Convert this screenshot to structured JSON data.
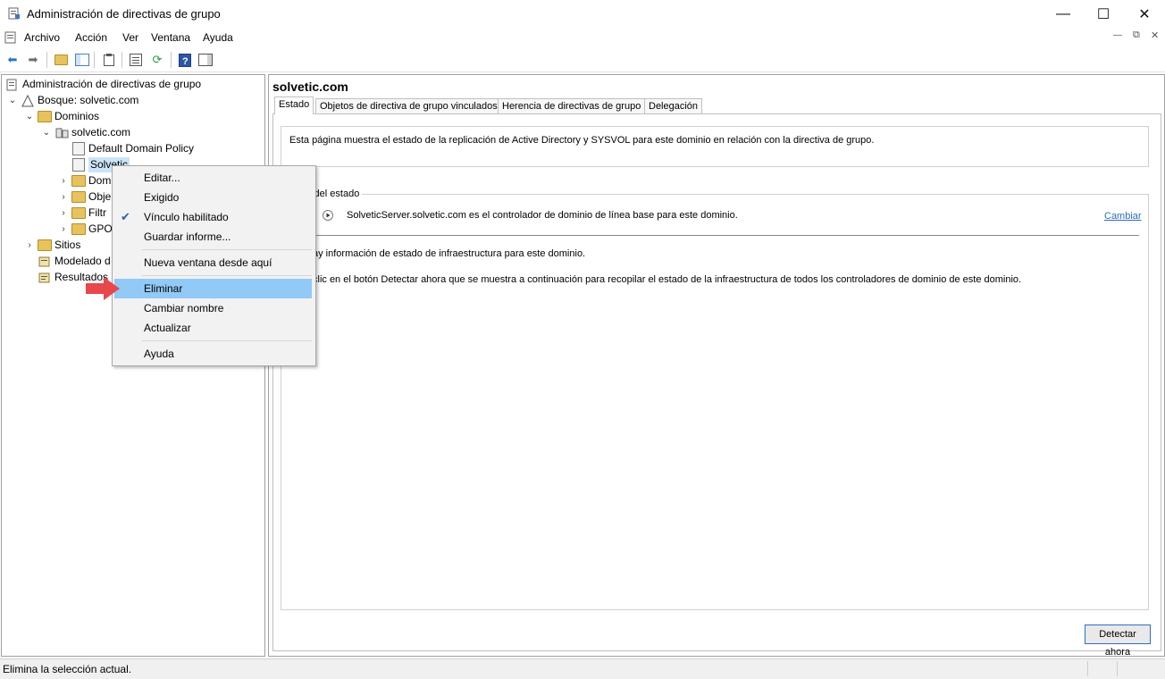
{
  "window": {
    "title": "Administración de directivas de grupo"
  },
  "menu": [
    "Archivo",
    "Acción",
    "Ver",
    "Ventana",
    "Ayuda"
  ],
  "tree": {
    "root": "Administración de directivas de grupo",
    "forest": "Bosque: solvetic.com",
    "domains": "Dominios",
    "domain": "solvetic.com",
    "ddp": "Default Domain Policy",
    "ou": "Solvetic",
    "child1": "Dom",
    "child2": "Obje",
    "child3": "Filtr",
    "child4": "GPO",
    "sites": "Sitios",
    "modeling": "Modelado d",
    "results": "Resultados"
  },
  "right": {
    "title": "solvetic.com",
    "tabs": [
      "Estado",
      "Objetos de directiva de grupo vinculados",
      "Herencia de directivas de grupo",
      "Delegación"
    ],
    "intro": "Esta página muestra el estado de la replicación de Active Directory y SYSVOL para este dominio en relación con la directiva de grupo.",
    "group_label": "s del estado",
    "baseline": "SolveticServer.solvetic.com es el controlador de dominio de línea base para este dominio.",
    "change_link": "Cambiar",
    "no_info": "ay información de estado de infraestructura para este dominio.",
    "instructions": " clic en el botón Detectar ahora que se muestra a continuación para recopilar el estado de la infraestructura de todos los controladores de dominio de este dominio.",
    "detect_button": "Detectar ahora"
  },
  "context_menu": {
    "edit": "Editar...",
    "enforced": "Exigido",
    "link_enabled": "Vínculo habilitado",
    "save_report": "Guardar informe...",
    "new_window": "Nueva ventana desde aquí",
    "delete": "Eliminar",
    "rename": "Cambiar nombre",
    "refresh": "Actualizar",
    "help": "Ayuda"
  },
  "status": {
    "text": "Elimina la selección actual."
  },
  "colors": {
    "highlight": "#91c9f7",
    "link": "#2a6fb8",
    "arrow": "#e8474c"
  }
}
